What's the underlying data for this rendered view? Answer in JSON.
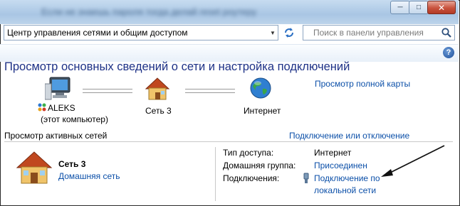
{
  "window": {
    "title": "Если не знаешь пароля тогда делай reset роутеру",
    "controls": {
      "minimize": "─",
      "maximize": "□",
      "close": "✕"
    }
  },
  "address": {
    "path": "Центр управления сетями и общим доступом"
  },
  "search": {
    "placeholder": "Поиск в панели управления"
  },
  "page": {
    "heading": "Просмотр основных сведений о сети и настройка подключений"
  },
  "map": {
    "full_map_link": "Просмотр полной карты",
    "computer": {
      "name": "ALEKS",
      "caption": "(этот компьютер)"
    },
    "network": {
      "name": "Сеть  3"
    },
    "internet": {
      "name": "Интернет"
    }
  },
  "active": {
    "section_title": "Просмотр активных сетей",
    "connect_link": "Подключение или отключение",
    "network_name": "Сеть  3",
    "network_type": "Домашняя сеть",
    "access_type_label": "Тип доступа:",
    "access_type_value": "Интернет",
    "homegroup_label": "Домашняя группа:",
    "homegroup_value": "Присоединен",
    "connections_label": "Подключения:",
    "connection_line1": "Подключение по",
    "connection_line2": "локальной сети"
  },
  "icons": {
    "computer": "computer-icon",
    "house": "house-icon",
    "globe": "globe-icon",
    "refresh": "refresh-icon",
    "search": "search-icon",
    "help": "help-icon",
    "ethernet": "ethernet-icon"
  },
  "colors": {
    "link": "#0b4fa8",
    "heading": "#1e3287"
  }
}
